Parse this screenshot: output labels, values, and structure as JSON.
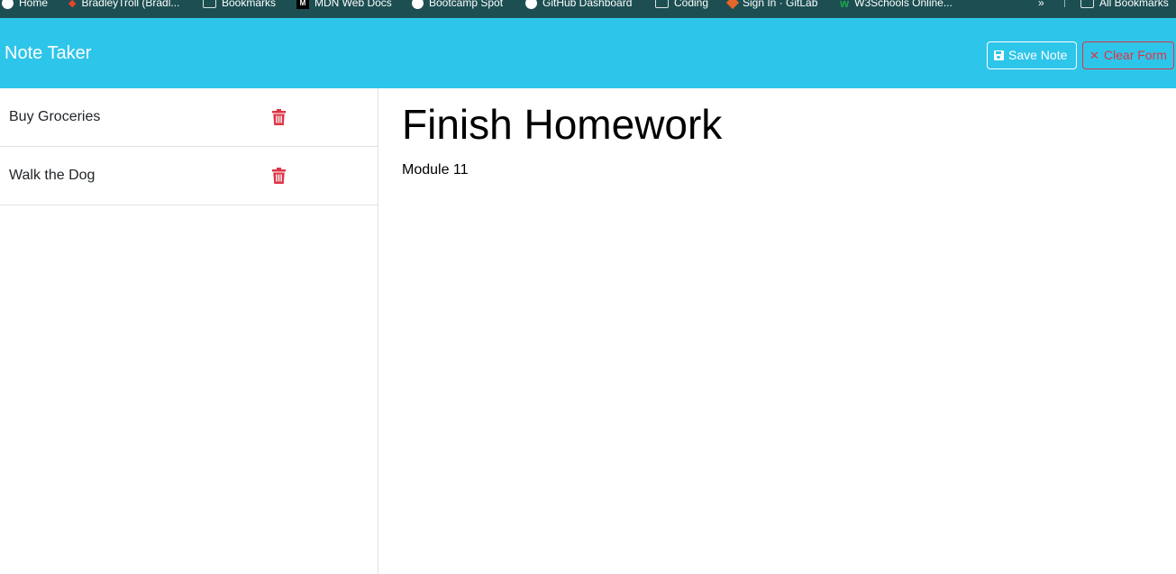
{
  "bookmarks": {
    "items": [
      {
        "label": "Home",
        "icon": "globe-icon"
      },
      {
        "label": "BradleyTroll (Bradl...",
        "icon": "app-icon"
      },
      {
        "label": "Bookmarks",
        "icon": "folder-icon"
      },
      {
        "label": "MDN Web Docs",
        "icon": "mdn-icon"
      },
      {
        "label": "Bootcamp Spot",
        "icon": "globe-icon"
      },
      {
        "label": "GitHub Dashboard",
        "icon": "github-icon"
      },
      {
        "label": "Coding",
        "icon": "folder-icon"
      },
      {
        "label": "Sign In · GitLab",
        "icon": "gitlab-icon"
      },
      {
        "label": "W3Schools Online...",
        "icon": "w3schools-icon"
      }
    ],
    "more_label": "»",
    "all_label": "All Bookmarks"
  },
  "navbar": {
    "brand": "Note Taker",
    "save_label": "Save Note",
    "clear_label": "Clear Form",
    "background": "#2ec5ea",
    "danger_color": "#dc3545"
  },
  "notes": [
    {
      "title": "Buy Groceries"
    },
    {
      "title": "Walk the Dog"
    }
  ],
  "active_note": {
    "title": "Finish Homework",
    "text": "Module 11"
  }
}
